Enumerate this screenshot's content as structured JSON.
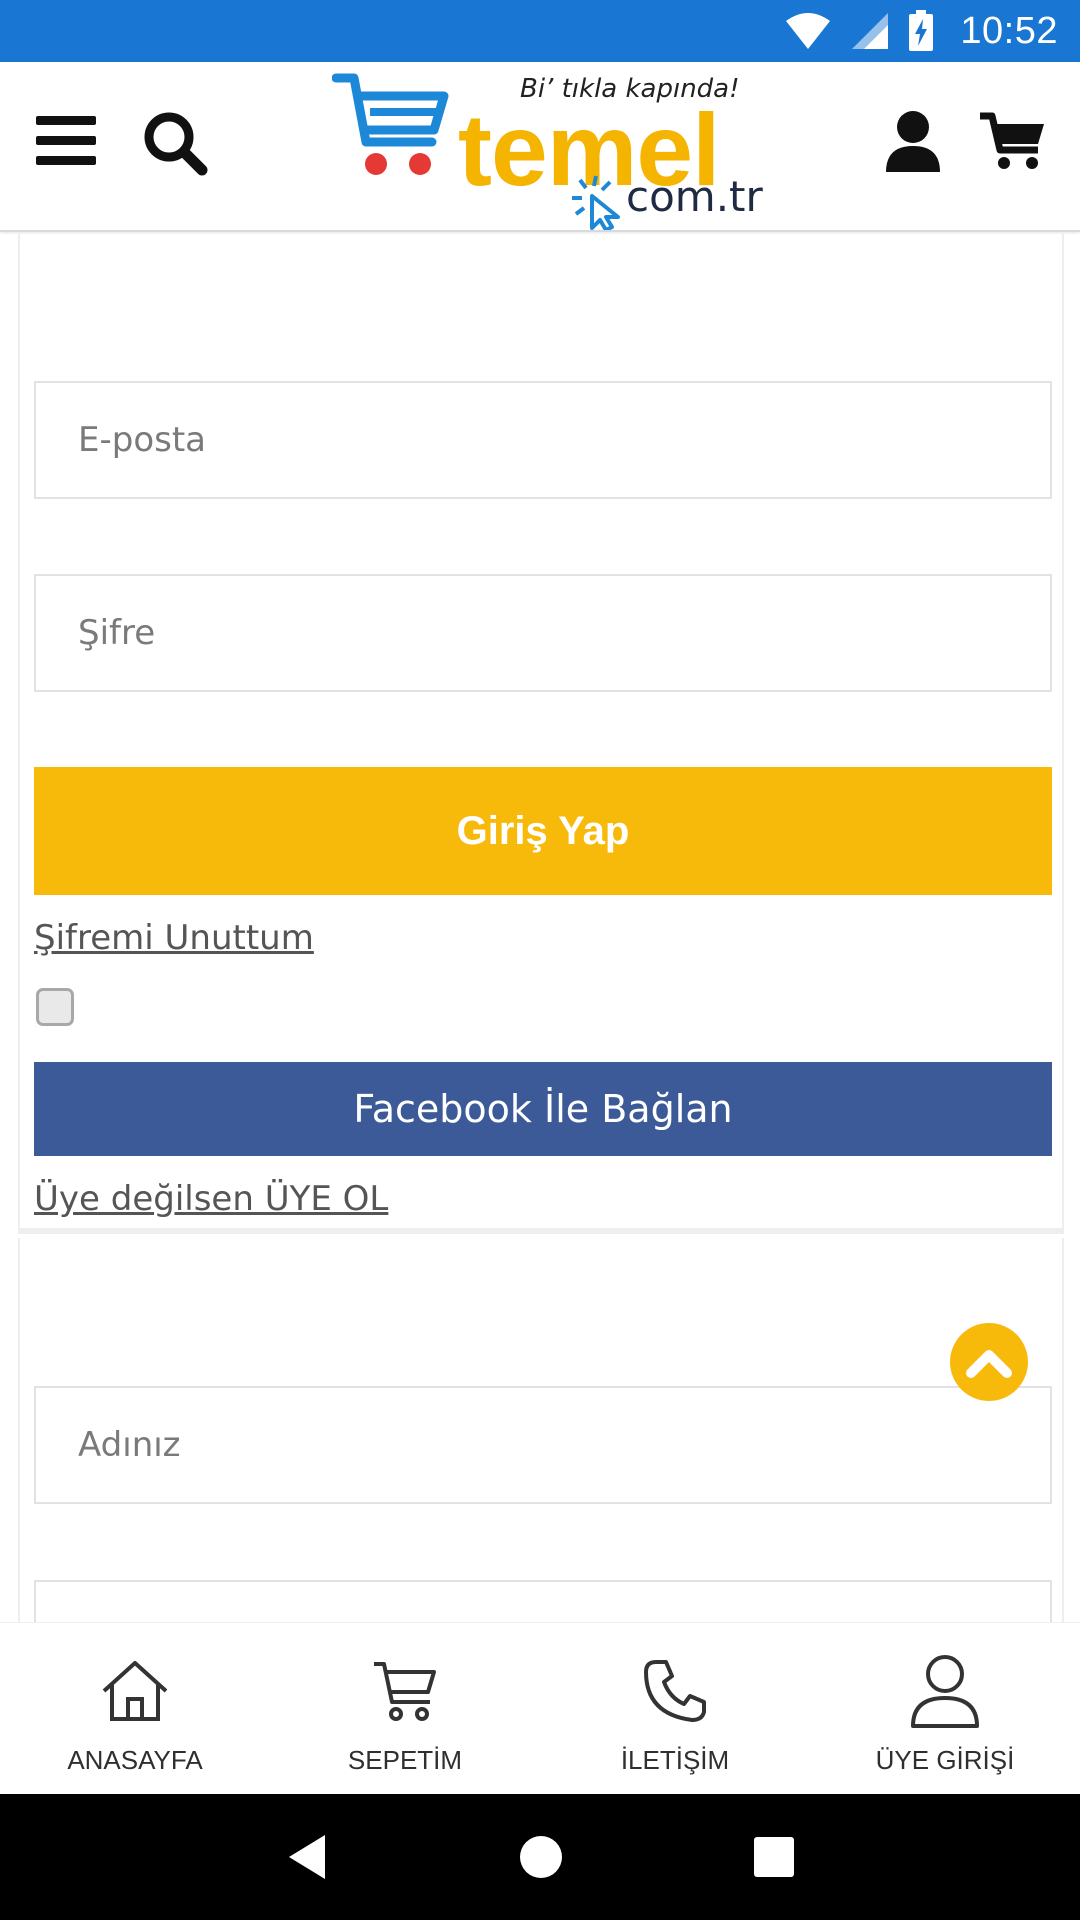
{
  "status_bar": {
    "time": "10:52",
    "icons": [
      "wifi-icon",
      "signal-icon",
      "battery-charging-icon"
    ]
  },
  "header": {
    "menu_icon": "hamburger-menu-icon",
    "search_icon": "search-icon",
    "logo": {
      "tagline": "Bi’ tıkla kapında!",
      "wordmark": "temel",
      "domain": "com.tr"
    },
    "account_icon": "user-icon",
    "cart_icon": "cart-icon"
  },
  "login_form": {
    "email_placeholder": "E-posta",
    "password_placeholder": "Şifre",
    "submit_label": "Giriş Yap",
    "forgot_password_label": "Şifremi Unuttum",
    "facebook_label": "Facebook İle Bağlan",
    "register_link_label": "Üye değilsen ÜYE OL"
  },
  "register_form": {
    "name_placeholder": "Adınız"
  },
  "bottom_nav": {
    "items": [
      {
        "label": "ANASAYFA",
        "icon": "home-icon"
      },
      {
        "label": "SEPETİM",
        "icon": "cart-outline-icon"
      },
      {
        "label": "İLETİŞİM",
        "icon": "phone-icon"
      },
      {
        "label": "ÜYE GİRİŞİ",
        "icon": "user-outline-icon"
      }
    ]
  },
  "colors": {
    "status_bar": "#1976d2",
    "accent_yellow": "#f7b90a",
    "facebook_blue": "#3d5a98",
    "logo_blue": "#1e88d8",
    "logo_red": "#e53935"
  }
}
